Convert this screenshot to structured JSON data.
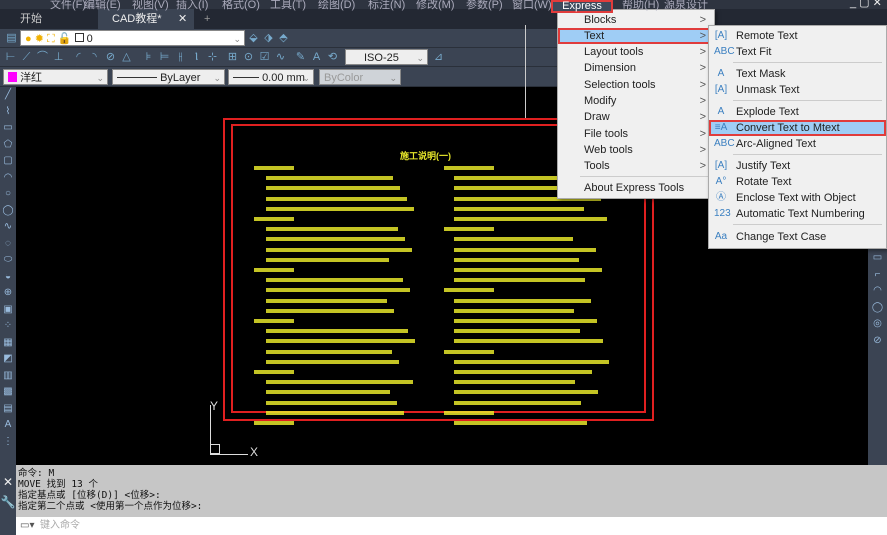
{
  "menubar": {
    "items": [
      "文件(F)",
      "编辑(E)",
      "视图(V)",
      "插入(I)",
      "格式(O)",
      "工具(T)",
      "绘图(D)",
      "标注(N)",
      "修改(M)",
      "参数(P)",
      "窗口(W)",
      "Express",
      "帮助(H)",
      "源泉设计"
    ]
  },
  "tabs": [
    {
      "label": "开始"
    },
    {
      "label": "CAD教程*",
      "active": true
    }
  ],
  "tab_add": "+",
  "tab_close": "✕",
  "layer": {
    "value": "0"
  },
  "dimstyle": {
    "value": "ISO-25"
  },
  "properties": {
    "color": "洋红",
    "color_hex": "#ff00ff",
    "linetype": "ByLayer",
    "lineweight": "0.00 mm",
    "plotstyle": "ByColor"
  },
  "drawing": {
    "title": "施工说明(一)",
    "frame_color": "#e02020",
    "text_color": "#e6e62a"
  },
  "ucs": {
    "y": "Y",
    "x": "X"
  },
  "express_menu": {
    "items": [
      {
        "label": "Blocks",
        "arrow": ">"
      },
      {
        "label": "Text",
        "arrow": ">",
        "selected": true
      },
      {
        "label": "Layout tools",
        "arrow": ">"
      },
      {
        "label": "Dimension",
        "arrow": ">"
      },
      {
        "label": "Selection tools",
        "arrow": ">"
      },
      {
        "label": "Modify",
        "arrow": ">"
      },
      {
        "label": "Draw",
        "arrow": ">"
      },
      {
        "label": "File tools",
        "arrow": ">"
      },
      {
        "label": "Web tools",
        "arrow": ">"
      },
      {
        "label": "Tools",
        "arrow": ">"
      },
      {
        "label": "About Express Tools"
      }
    ]
  },
  "text_submenu": {
    "items": [
      {
        "label": "Remote Text",
        "icon": "[A]"
      },
      {
        "label": "Text Fit",
        "icon": "ABC"
      },
      {
        "label": "Text Mask",
        "icon": "A"
      },
      {
        "label": "Unmask Text",
        "icon": "[A]"
      },
      {
        "label": "Explode Text",
        "icon": "A"
      },
      {
        "label": "Convert Text to Mtext",
        "icon": "≡A",
        "selected": true
      },
      {
        "label": "Arc-Aligned Text",
        "icon": "ABC"
      },
      {
        "label": "Justify Text",
        "icon": "[A]"
      },
      {
        "label": "Rotate Text",
        "icon": "A°"
      },
      {
        "label": "Enclose Text with Object",
        "icon": "Ⓐ"
      },
      {
        "label": "Automatic Text Numbering",
        "icon": "123"
      },
      {
        "label": "Change Text Case",
        "icon": "Aa"
      }
    ]
  },
  "command": {
    "history": [
      "命令: M",
      "MOVE 找到 13 个",
      "指定基点或 [位移(D)] <位移>:",
      "指定第二个点或 <使用第一个点作为位移>:"
    ],
    "placeholder": "键入命令"
  },
  "accent": {
    "highlight": "#9fcdf5",
    "callout": "#e03c3c"
  }
}
